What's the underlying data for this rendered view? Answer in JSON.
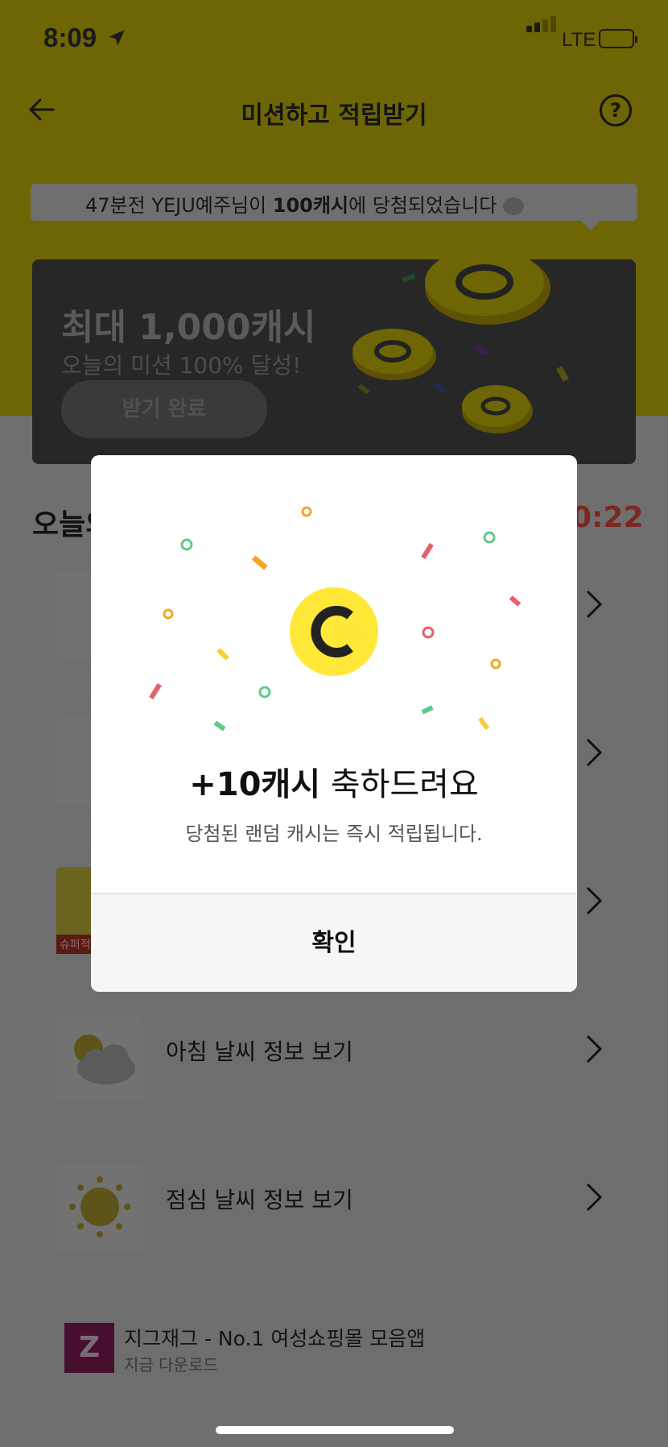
{
  "status_bar": {
    "time": "8:09",
    "network": "LTE"
  },
  "nav": {
    "title": "미션하고 적립받기",
    "help_label": "?"
  },
  "ticker": {
    "prefix": "47분전 YEJU예주님이 ",
    "amount": "100캐시",
    "suffix": "에 당첨되었습니다"
  },
  "banner": {
    "title": "최대 1,000캐시",
    "subtitle": "오늘의 미션 100% 달성!",
    "button": "받기 완료"
  },
  "section": {
    "title": "오늘의",
    "countdown": "0:22"
  },
  "missions": [
    {
      "label": ""
    },
    {
      "label": ""
    },
    {
      "label": "",
      "badge": "슈퍼적"
    },
    {
      "label": "아침 날씨 정보 보기"
    },
    {
      "label": "점심 날씨 정보 보기"
    }
  ],
  "ad": {
    "logo": "Z",
    "name": "지그재그 - No.1 여성쇼핑몰 모음앱",
    "sub": "지금 다운로드"
  },
  "modal": {
    "coin_letter": "C",
    "amount": "+10캐시",
    "message": " 축하드려요",
    "description": "당첨된 랜덤 캐시는 즉시 적립됩니다.",
    "confirm": "확인"
  },
  "colors": {
    "brand_yellow": "#FFE838",
    "modal_bg": "#FFFFFF",
    "countdown_red": "#E0473C"
  }
}
